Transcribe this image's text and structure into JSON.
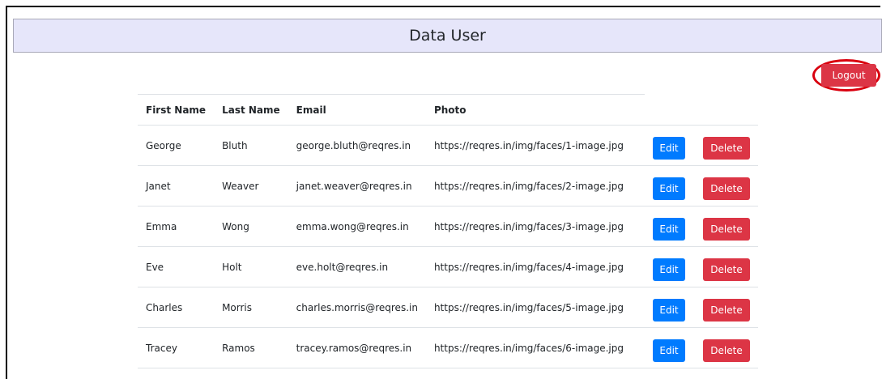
{
  "header": {
    "title": "Data User"
  },
  "toolbar": {
    "logout_label": "Logout"
  },
  "table": {
    "columns": [
      "First Name",
      "Last Name",
      "Email",
      "Photo"
    ],
    "rows": [
      {
        "first": "George",
        "last": "Bluth",
        "email": "george.bluth@reqres.in",
        "photo": "https://reqres.in/img/faces/1-image.jpg",
        "edit": "Edit",
        "delete": "Delete"
      },
      {
        "first": "Janet",
        "last": "Weaver",
        "email": "janet.weaver@reqres.in",
        "photo": "https://reqres.in/img/faces/2-image.jpg",
        "edit": "Edit",
        "delete": "Delete"
      },
      {
        "first": "Emma",
        "last": "Wong",
        "email": "emma.wong@reqres.in",
        "photo": "https://reqres.in/img/faces/3-image.jpg",
        "edit": "Edit",
        "delete": "Delete"
      },
      {
        "first": "Eve",
        "last": "Holt",
        "email": "eve.holt@reqres.in",
        "photo": "https://reqres.in/img/faces/4-image.jpg",
        "edit": "Edit",
        "delete": "Delete"
      },
      {
        "first": "Charles",
        "last": "Morris",
        "email": "charles.morris@reqres.in",
        "photo": "https://reqres.in/img/faces/5-image.jpg",
        "edit": "Edit",
        "delete": "Delete"
      },
      {
        "first": "Tracey",
        "last": "Ramos",
        "email": "tracey.ramos@reqres.in",
        "photo": "https://reqres.in/img/faces/6-image.jpg",
        "edit": "Edit",
        "delete": "Delete"
      }
    ]
  },
  "colors": {
    "header_bg": "#e6e6fa",
    "primary": "#007bff",
    "danger": "#dc3545",
    "highlight_ring": "#d9000f"
  }
}
